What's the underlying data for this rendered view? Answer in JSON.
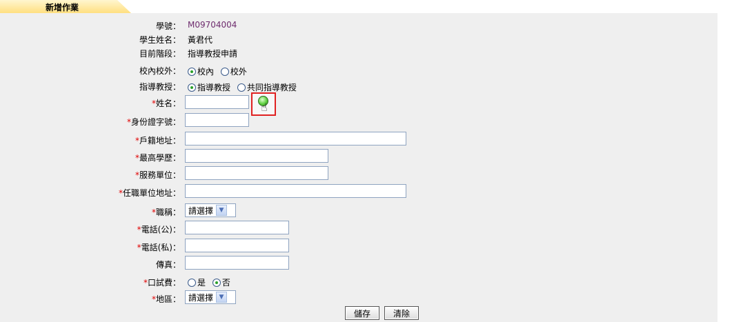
{
  "header": {
    "title": "新增作業"
  },
  "student": {
    "id_label": "學號：",
    "id_value": "M09704004",
    "name_label": "學生姓名：",
    "name_value": "黃君代",
    "stage_label": "目前階段：",
    "stage_value": "指導教授申請"
  },
  "campus": {
    "label": "校內校外：",
    "options": [
      "校內",
      "校外"
    ],
    "selected": "校內"
  },
  "advisor_type": {
    "label": "指導教授：",
    "options": [
      "指導教授",
      "共同指導教授"
    ],
    "selected": "指導教授"
  },
  "fields": {
    "required_mark": "*",
    "name_label": "姓名：",
    "name_value": "",
    "id_number_label": "身份證字號：",
    "id_number_value": "",
    "address_label": "戶籍地址：",
    "address_value": "",
    "education_label": "最高學歷：",
    "education_value": "",
    "employer_label": "服務單位：",
    "employer_value": "",
    "employer_address_label": "任職單位地址：",
    "employer_address_value": "",
    "title_label": "職稱：",
    "title_selected": "請選擇",
    "phone_office_label": "電話(公)：",
    "phone_office_value": "",
    "phone_home_label": "電話(私)：",
    "phone_home_value": "",
    "fax_label": "傳真：",
    "fax_value": ""
  },
  "oral_fee": {
    "label": "口試費：",
    "options": [
      "是",
      "否"
    ],
    "selected": "否"
  },
  "region": {
    "label": "地區：",
    "selected": "請選擇"
  },
  "buttons": {
    "save": "儲存",
    "clear": "清除"
  },
  "icons": {
    "search": "search-icon",
    "cursor": "hand-pointer-icon"
  },
  "colors": {
    "tab": "#ffdf80",
    "panel": "#efefef",
    "required": "#e00000",
    "highlight": "#e02020",
    "id_value": "#6e2c6e"
  }
}
